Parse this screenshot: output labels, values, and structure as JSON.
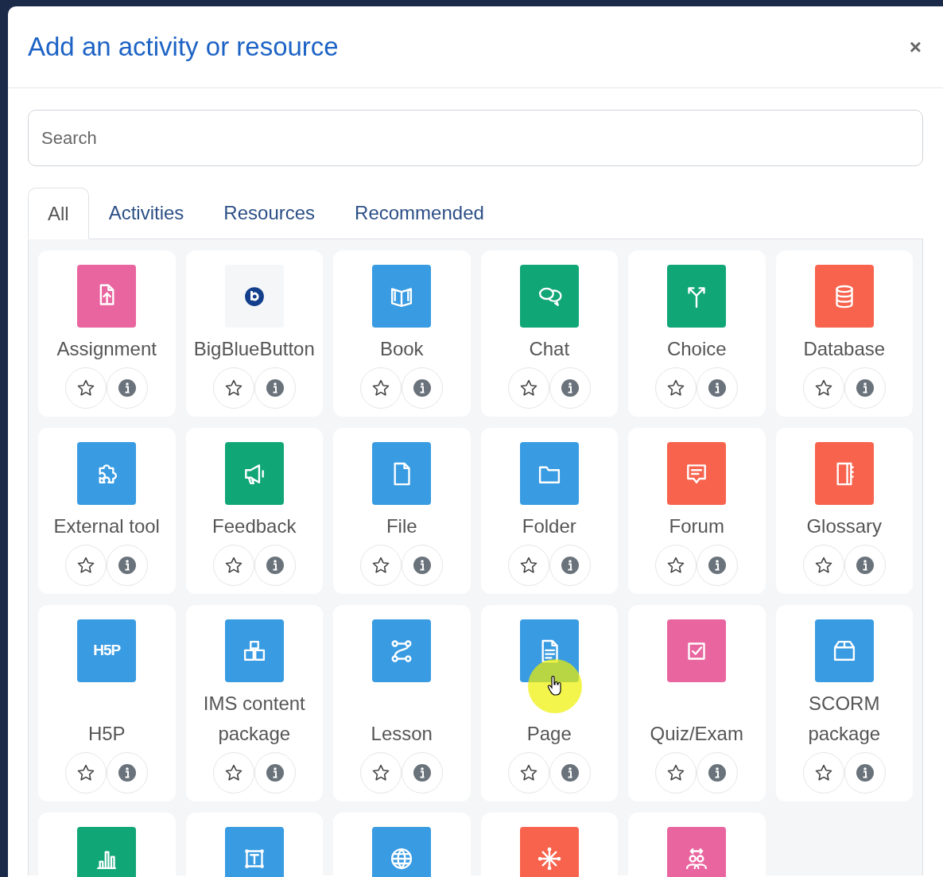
{
  "dialog": {
    "title": "Add an activity or resource",
    "close": "×"
  },
  "search": {
    "placeholder": "Search"
  },
  "tabs": [
    {
      "label": "All",
      "selected": true
    },
    {
      "label": "Activities",
      "selected": false
    },
    {
      "label": "Resources",
      "selected": false
    },
    {
      "label": "Recommended",
      "selected": false
    }
  ],
  "items": [
    {
      "label": "Assignment",
      "kind": "assignment",
      "color": "#e9659f"
    },
    {
      "label": "BigBlueButton",
      "kind": "bbb",
      "color": "#f5f6f8"
    },
    {
      "label": "Book",
      "kind": "book",
      "color": "#399be2"
    },
    {
      "label": "Chat",
      "kind": "chat",
      "color": "#11a676"
    },
    {
      "label": "Choice",
      "kind": "choice",
      "color": "#11a676"
    },
    {
      "label": "Database",
      "kind": "database",
      "color": "#f7634d"
    },
    {
      "label": "External tool",
      "kind": "puzzle",
      "color": "#399be2"
    },
    {
      "label": "Feedback",
      "kind": "megaphone",
      "color": "#11a676"
    },
    {
      "label": "File",
      "kind": "file",
      "color": "#399be2"
    },
    {
      "label": "Folder",
      "kind": "folder",
      "color": "#399be2"
    },
    {
      "label": "Forum",
      "kind": "forum",
      "color": "#f7634d"
    },
    {
      "label": "Glossary",
      "kind": "glossary",
      "color": "#f7634d"
    },
    {
      "label": "H5P",
      "kind": "h5p",
      "logo_text": "H5P",
      "color": "#399be2"
    },
    {
      "label": "IMS content package",
      "kind": "boxes",
      "color": "#399be2"
    },
    {
      "label": "Lesson",
      "kind": "path",
      "color": "#399be2"
    },
    {
      "label": "Page",
      "kind": "page",
      "color": "#399be2",
      "hovered": true
    },
    {
      "label": "Quiz/Exam",
      "kind": "quiz",
      "color": "#e9659f"
    },
    {
      "label": "SCORM package",
      "kind": "scorm",
      "color": "#399be2"
    },
    {
      "kind": "chart",
      "color": "#11a676"
    },
    {
      "kind": "textframe",
      "color": "#399be2"
    },
    {
      "kind": "globe",
      "color": "#399be2"
    },
    {
      "kind": "network",
      "color": "#f7634d"
    },
    {
      "kind": "people",
      "color": "#e9659f"
    }
  ]
}
